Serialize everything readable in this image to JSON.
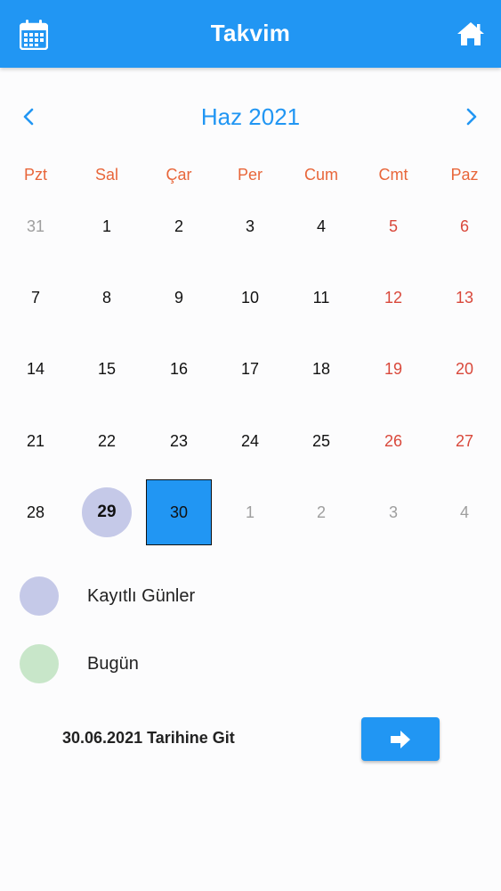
{
  "appbar": {
    "title": "Takvim",
    "left_icon": "calendar-icon",
    "right_icon": "home-icon",
    "color": "#2196f3"
  },
  "calendar": {
    "month_title": "Haz 2021",
    "prev_icon": "chevron-left-icon",
    "next_icon": "chevron-right-icon",
    "weekdays": [
      "Pzt",
      "Sal",
      "Çar",
      "Per",
      "Cum",
      "Cmt",
      "Paz"
    ],
    "weeks": [
      [
        {
          "d": "31",
          "kind": "muted"
        },
        {
          "d": "1"
        },
        {
          "d": "2"
        },
        {
          "d": "3"
        },
        {
          "d": "4"
        },
        {
          "d": "5",
          "kind": "weekend"
        },
        {
          "d": "6",
          "kind": "weekend"
        }
      ],
      [
        {
          "d": "7"
        },
        {
          "d": "8"
        },
        {
          "d": "9"
        },
        {
          "d": "10"
        },
        {
          "d": "11"
        },
        {
          "d": "12",
          "kind": "weekend"
        },
        {
          "d": "13",
          "kind": "weekend"
        }
      ],
      [
        {
          "d": "14"
        },
        {
          "d": "15"
        },
        {
          "d": "16"
        },
        {
          "d": "17"
        },
        {
          "d": "18"
        },
        {
          "d": "19",
          "kind": "weekend"
        },
        {
          "d": "20",
          "kind": "weekend"
        }
      ],
      [
        {
          "d": "21"
        },
        {
          "d": "22"
        },
        {
          "d": "23"
        },
        {
          "d": "24"
        },
        {
          "d": "25"
        },
        {
          "d": "26",
          "kind": "weekend"
        },
        {
          "d": "27",
          "kind": "weekend"
        }
      ],
      [
        {
          "d": "28"
        },
        {
          "d": "29",
          "kind": "saved"
        },
        {
          "d": "30",
          "kind": "selected"
        },
        {
          "d": "1",
          "kind": "muted"
        },
        {
          "d": "2",
          "kind": "muted"
        },
        {
          "d": "3",
          "kind": "muted"
        },
        {
          "d": "4",
          "kind": "muted"
        }
      ]
    ],
    "colors": {
      "weekday_header": "#e8663a",
      "weekend": "#d9483b",
      "muted": "#9e9e9e",
      "saved": "#c5c9e8",
      "selected": "#2196f3"
    }
  },
  "legend": [
    {
      "label": "Kayıtlı Günler",
      "color": "#c5c9e8"
    },
    {
      "label": "Bugün",
      "color": "#c8e6c9"
    }
  ],
  "goto": {
    "label": "30.06.2021 Tarihine Git",
    "button_icon": "arrow-right-icon"
  }
}
